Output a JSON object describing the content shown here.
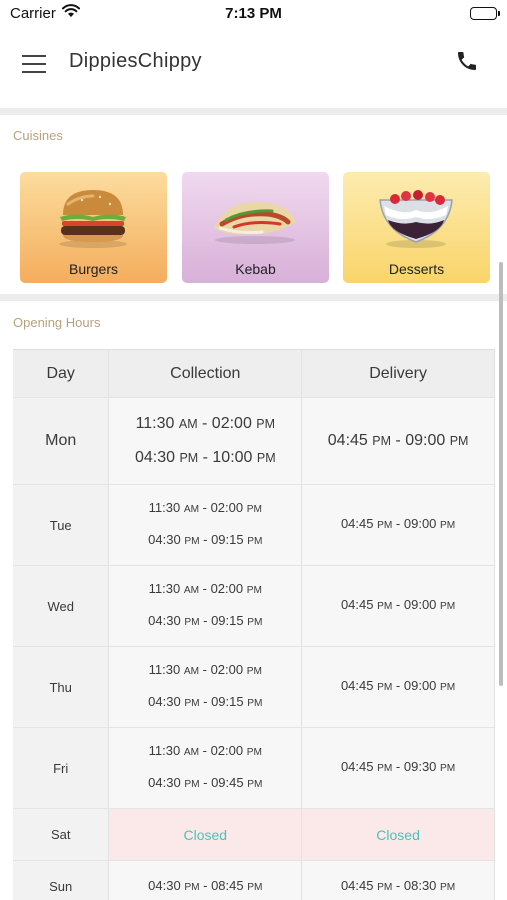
{
  "status": {
    "carrier": "Carrier",
    "time": "7:13 PM"
  },
  "header": {
    "title": "DippiesChippy",
    "menu_icon": "hamburger-menu-icon",
    "phone_icon": "phone-icon"
  },
  "cuisines": {
    "heading": "Cuisines",
    "items": [
      {
        "label": "Burgers",
        "icon": "burger-icon",
        "color": "#f4ad5c"
      },
      {
        "label": "Kebab",
        "icon": "kebab-icon",
        "color": "#d8b0d8"
      },
      {
        "label": "Desserts",
        "icon": "dessert-icon",
        "color": "#f9d469"
      }
    ]
  },
  "hours": {
    "heading": "Opening Hours",
    "columns": [
      "Day",
      "Collection",
      "Delivery"
    ],
    "rows": [
      {
        "day": "Mon",
        "collection": [
          {
            "from": "11:30",
            "from_ampm": "AM",
            "to": "02:00",
            "to_ampm": "PM"
          },
          {
            "from": "04:30",
            "from_ampm": "PM",
            "to": "10:00",
            "to_ampm": "PM"
          }
        ],
        "delivery": [
          {
            "from": "04:45",
            "from_ampm": "PM",
            "to": "09:00",
            "to_ampm": "PM"
          }
        ]
      },
      {
        "day": "Tue",
        "collection": [
          {
            "from": "11:30",
            "from_ampm": "AM",
            "to": "02:00",
            "to_ampm": "PM"
          },
          {
            "from": "04:30",
            "from_ampm": "PM",
            "to": "09:15",
            "to_ampm": "PM"
          }
        ],
        "delivery": [
          {
            "from": "04:45",
            "from_ampm": "PM",
            "to": "09:00",
            "to_ampm": "PM"
          }
        ]
      },
      {
        "day": "Wed",
        "collection": [
          {
            "from": "11:30",
            "from_ampm": "AM",
            "to": "02:00",
            "to_ampm": "PM"
          },
          {
            "from": "04:30",
            "from_ampm": "PM",
            "to": "09:15",
            "to_ampm": "PM"
          }
        ],
        "delivery": [
          {
            "from": "04:45",
            "from_ampm": "PM",
            "to": "09:00",
            "to_ampm": "PM"
          }
        ]
      },
      {
        "day": "Thu",
        "collection": [
          {
            "from": "11:30",
            "from_ampm": "AM",
            "to": "02:00",
            "to_ampm": "PM"
          },
          {
            "from": "04:30",
            "from_ampm": "PM",
            "to": "09:15",
            "to_ampm": "PM"
          }
        ],
        "delivery": [
          {
            "from": "04:45",
            "from_ampm": "PM",
            "to": "09:00",
            "to_ampm": "PM"
          }
        ]
      },
      {
        "day": "Fri",
        "collection": [
          {
            "from": "11:30",
            "from_ampm": "AM",
            "to": "02:00",
            "to_ampm": "PM"
          },
          {
            "from": "04:30",
            "from_ampm": "PM",
            "to": "09:45",
            "to_ampm": "PM"
          }
        ],
        "delivery": [
          {
            "from": "04:45",
            "from_ampm": "PM",
            "to": "09:30",
            "to_ampm": "PM"
          }
        ]
      },
      {
        "day": "Sat",
        "closed_label": "Closed",
        "closed_color": "#4cc2b6"
      },
      {
        "day": "Sun",
        "collection": [
          {
            "from": "04:30",
            "from_ampm": "PM",
            "to": "08:45",
            "to_ampm": "PM"
          }
        ],
        "delivery": [
          {
            "from": "04:45",
            "from_ampm": "PM",
            "to": "08:30",
            "to_ampm": "PM"
          }
        ]
      }
    ]
  }
}
